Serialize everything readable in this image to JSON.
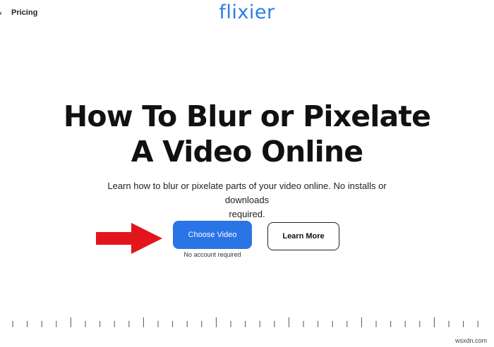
{
  "nav": {
    "pricing_label": "Pricing"
  },
  "logo": {
    "text": "flixier"
  },
  "hero": {
    "title_line1": "How To Blur or Pixelate",
    "title_line2": "A Video Online",
    "subtitle_line1": "Learn how to blur or pixelate parts of your video online. No installs or downloads",
    "subtitle_line2": "required."
  },
  "actions": {
    "choose_video_label": "Choose Video",
    "choose_video_note": "No account required",
    "learn_more_label": "Learn More"
  },
  "watermark": {
    "text": "wsxdn.com"
  },
  "colors": {
    "brand": "#2b7de9",
    "button": "#2b74e6",
    "arrow": "#e3151c"
  }
}
